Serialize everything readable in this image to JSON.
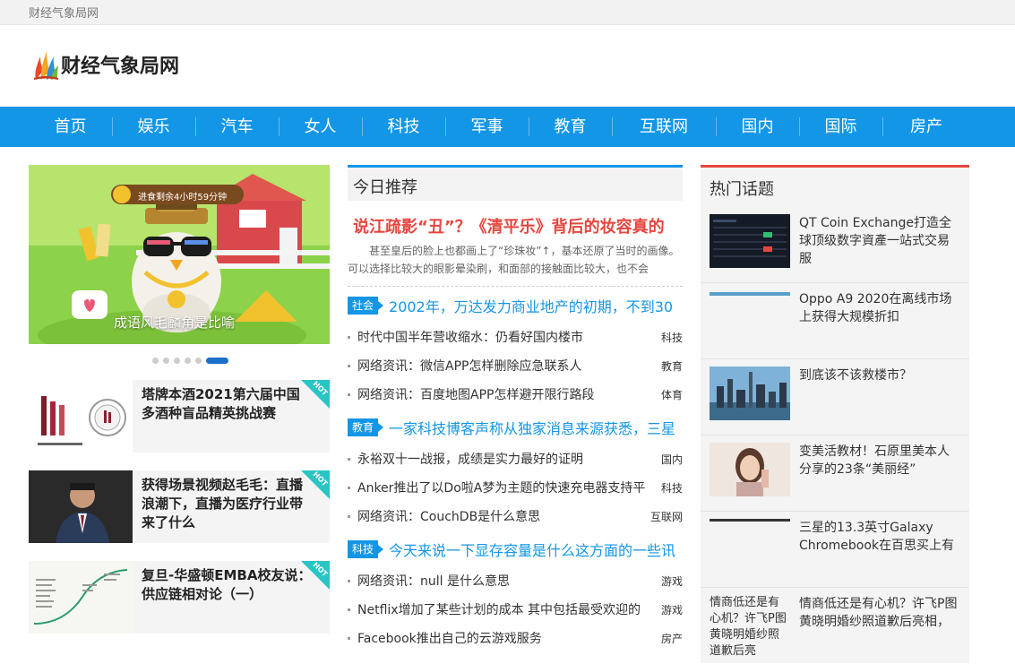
{
  "site": {
    "topbar_text": "财经气象局网",
    "logo_text": "财经气象局网"
  },
  "nav": {
    "items": [
      "首页",
      "娱乐",
      "汽车",
      "女人",
      "科技",
      "军事",
      "教育",
      "互联网",
      "国内",
      "国际",
      "房产"
    ]
  },
  "slider": {
    "badge_text": "进食剩余4小时59分钟",
    "caption": "成语风毛麟角是比喻",
    "dot_count": 6,
    "active_dot": 5
  },
  "cards": [
    {
      "title": "塔牌本酒2021第六届中国多酒种盲品精英挑战赛",
      "hot": "HOT"
    },
    {
      "title": "获得场景视频赵毛毛：直播浪潮下，直播为医疗行业带来了什么",
      "hot": "HOT"
    },
    {
      "title": "复旦-华盛顿EMBA校友说：供应链相对论（一）",
      "hot": "HOT"
    }
  ],
  "recommend": {
    "section_title": "今日推荐",
    "headline": "说江疏影“丑”？《清平乐》背后的妆容真的",
    "summary": "甚至皇后的脸上也都画上了“珍珠妆”↑，基本还原了当时的画像。 可以选择比较大的眼影晕染刷，和面部的接触面比较大，也不会",
    "groups": [
      {
        "tag": "社会",
        "title": "2002年，万达发力商业地产的初期，不到30",
        "items": [
          {
            "text": "时代中国半年营收缩水：仍看好国内楼市",
            "cat": "科技"
          },
          {
            "text": "网络资讯：微信APP怎样删除应急联系人",
            "cat": "教育"
          },
          {
            "text": "网络资讯：百度地图APP怎样避开限行路段",
            "cat": "体育"
          }
        ]
      },
      {
        "tag": "教育",
        "title": "一家科技博客声称从独家消息来源获悉，三星",
        "items": [
          {
            "text": "永裕双十一战报，成绩是实力最好的证明",
            "cat": "国内"
          },
          {
            "text": "Anker推出了以Do啦A梦为主题的快速充电器支持平",
            "cat": "科技"
          },
          {
            "text": "网络资讯：CouchDB是什么意思",
            "cat": "互联网"
          }
        ]
      },
      {
        "tag": "科技",
        "title": "今天来说一下显存容量是什么这方面的一些讯",
        "items": [
          {
            "text": "网络资讯：null 是什么意思",
            "cat": "游戏"
          },
          {
            "text": "Netflix增加了某些计划的成本 其中包括最受欢迎的",
            "cat": "游戏"
          },
          {
            "text": "Facebook推出自己的云游戏服务",
            "cat": "房产"
          }
        ]
      }
    ]
  },
  "hot_topics": {
    "section_title": "热门话题",
    "items": [
      {
        "title": "QT Coin Exchange打造全球顶级数字資產一站式交易服"
      },
      {
        "title": "Oppo A9 2020在离线市场上获得大规模折扣"
      },
      {
        "title": "到底该不该救楼市？"
      },
      {
        "title": "变美活教材！石原里美本人分享的23条“美丽经”"
      },
      {
        "title": "三星的13.3英寸Galaxy Chromebook在百思买上有"
      },
      {
        "title": "情商低还是有心机？许飞P图黄晓明婚纱照道歉后亮相，",
        "alt": "情商低还是有心机？许飞P图黄晓明婚纱照道歉后亮"
      }
    ]
  },
  "colors": {
    "nav_blue": "#1496e6",
    "headline_red": "#e6463f",
    "hot_teal": "#29c5c5"
  }
}
